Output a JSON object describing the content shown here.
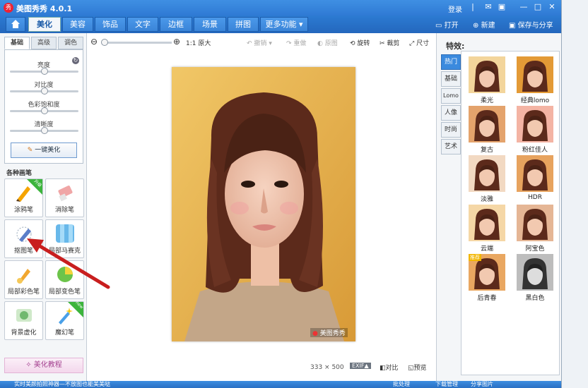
{
  "app": {
    "title": "美图秀秀 4.0.1",
    "logo_text": "秀",
    "login": "登录"
  },
  "menu": {
    "tabs": [
      {
        "label": "美化",
        "active": true
      },
      {
        "label": "美容"
      },
      {
        "label": "饰品"
      },
      {
        "label": "文字"
      },
      {
        "label": "边框"
      },
      {
        "label": "场景"
      },
      {
        "label": "拼图"
      },
      {
        "label": "更多功能"
      }
    ],
    "open": "打开",
    "new": "新建",
    "save": "保存与分享"
  },
  "left": {
    "subtabs": [
      "基础",
      "高级",
      "调色"
    ],
    "sliders": [
      {
        "label": "亮度",
        "level": 0.5
      },
      {
        "label": "对比度",
        "level": 0.5
      },
      {
        "label": "色彩饱和度",
        "level": 0.5
      },
      {
        "label": "清晰度",
        "level": 0.5
      }
    ],
    "onekey": "一键美化",
    "brush_header": "各种画笔",
    "brushes": [
      {
        "label": "涂鸦笔",
        "badge": "升级",
        "color": "#f5a400"
      },
      {
        "label": "消除笔",
        "color": "#f0a6a6"
      },
      {
        "label": "抠图笔",
        "color": "#5b7ec9"
      },
      {
        "label": "局部马赛克",
        "color": "#68b8ea"
      },
      {
        "label": "局部彩色笔",
        "color": "#f1a730"
      },
      {
        "label": "局部变色笔",
        "color": "#6cc44a"
      },
      {
        "label": "背景虚化",
        "color": "#71b86f"
      },
      {
        "label": "魔幻笔",
        "badge": "new",
        "color": "#4aa0e8"
      }
    ],
    "tutorial": "美化教程"
  },
  "toolbar": {
    "zoom_original": "1:1 原大",
    "undo": "撤销",
    "redo": "重做",
    "original": "原图",
    "rotate": "旋转",
    "crop": "裁剪",
    "size": "尺寸"
  },
  "canvas": {
    "watermark": "美图秀秀",
    "dimensions": "333 × 500",
    "exif": "EXIF▲",
    "compare": "对比",
    "preview": "预览"
  },
  "right": {
    "title": "特效:",
    "tabs": [
      "热门",
      "基础",
      "Lomo",
      "人像",
      "时尚",
      "艺术"
    ],
    "effects": [
      {
        "label": "柔光",
        "tint": "#f3d59b"
      },
      {
        "label": "经典lomo",
        "tint": "#e39a36"
      },
      {
        "label": "复古",
        "tint": "#e4a36c"
      },
      {
        "label": "粉红佳人",
        "tint": "#f4b4a4"
      },
      {
        "label": "淡雅",
        "tint": "#f2d9c2"
      },
      {
        "label": "HDR",
        "tint": "#e7a35e"
      },
      {
        "label": "云端",
        "tint": "#f5d7a6"
      },
      {
        "label": "阿宝色",
        "tint": "#e5b695"
      },
      {
        "label": "后青春",
        "tint": "#e9a761",
        "badge": "推荐"
      },
      {
        "label": "黑白色",
        "tint": "#bdbdbd"
      }
    ]
  },
  "statusbar": {
    "items": [
      "实时美颜拍照神器—不放图也能美美哒",
      "批处理",
      "下载管理",
      "分享图片"
    ]
  }
}
